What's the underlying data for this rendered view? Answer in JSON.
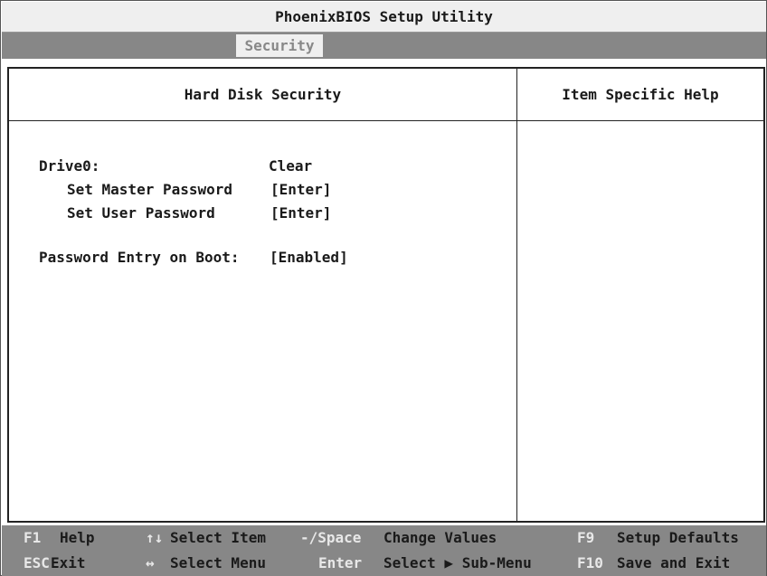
{
  "title": "PhoenixBIOS Setup Utility",
  "menu": {
    "active_tab": "Security"
  },
  "panel": {
    "left_heading": "Hard Disk Security",
    "right_heading": "Item Specific Help",
    "items": {
      "drive_label": "Drive0:",
      "drive_value": "Clear",
      "master_label": "Set Master Password",
      "master_value": "[Enter]",
      "user_label": "Set User Password",
      "user_value": "[Enter]",
      "boot_label": "Password Entry on Boot:",
      "boot_value": "[Enabled]"
    }
  },
  "status": {
    "f1_key": "F1",
    "f1_label": "Help",
    "updown_key": "↑↓",
    "updown_label": "Select Item",
    "minus_key": "-/Space",
    "minus_label": "Change Values",
    "f9_key": "F9",
    "f9_label": "Setup Defaults",
    "esc_key": "ESC",
    "esc_label": "Exit",
    "leftright_key": "↔",
    "leftright_label": "Select Menu",
    "enter_key": "Enter",
    "enter_label": "Select ▶ Sub-Menu",
    "f10_key": "F10",
    "f10_label": "Save and Exit"
  },
  "colors": {
    "bar_gray": "#878787",
    "panel_bg": "#ffffff",
    "key_text": "#e8e8e8",
    "text": "#1a1a1a"
  }
}
